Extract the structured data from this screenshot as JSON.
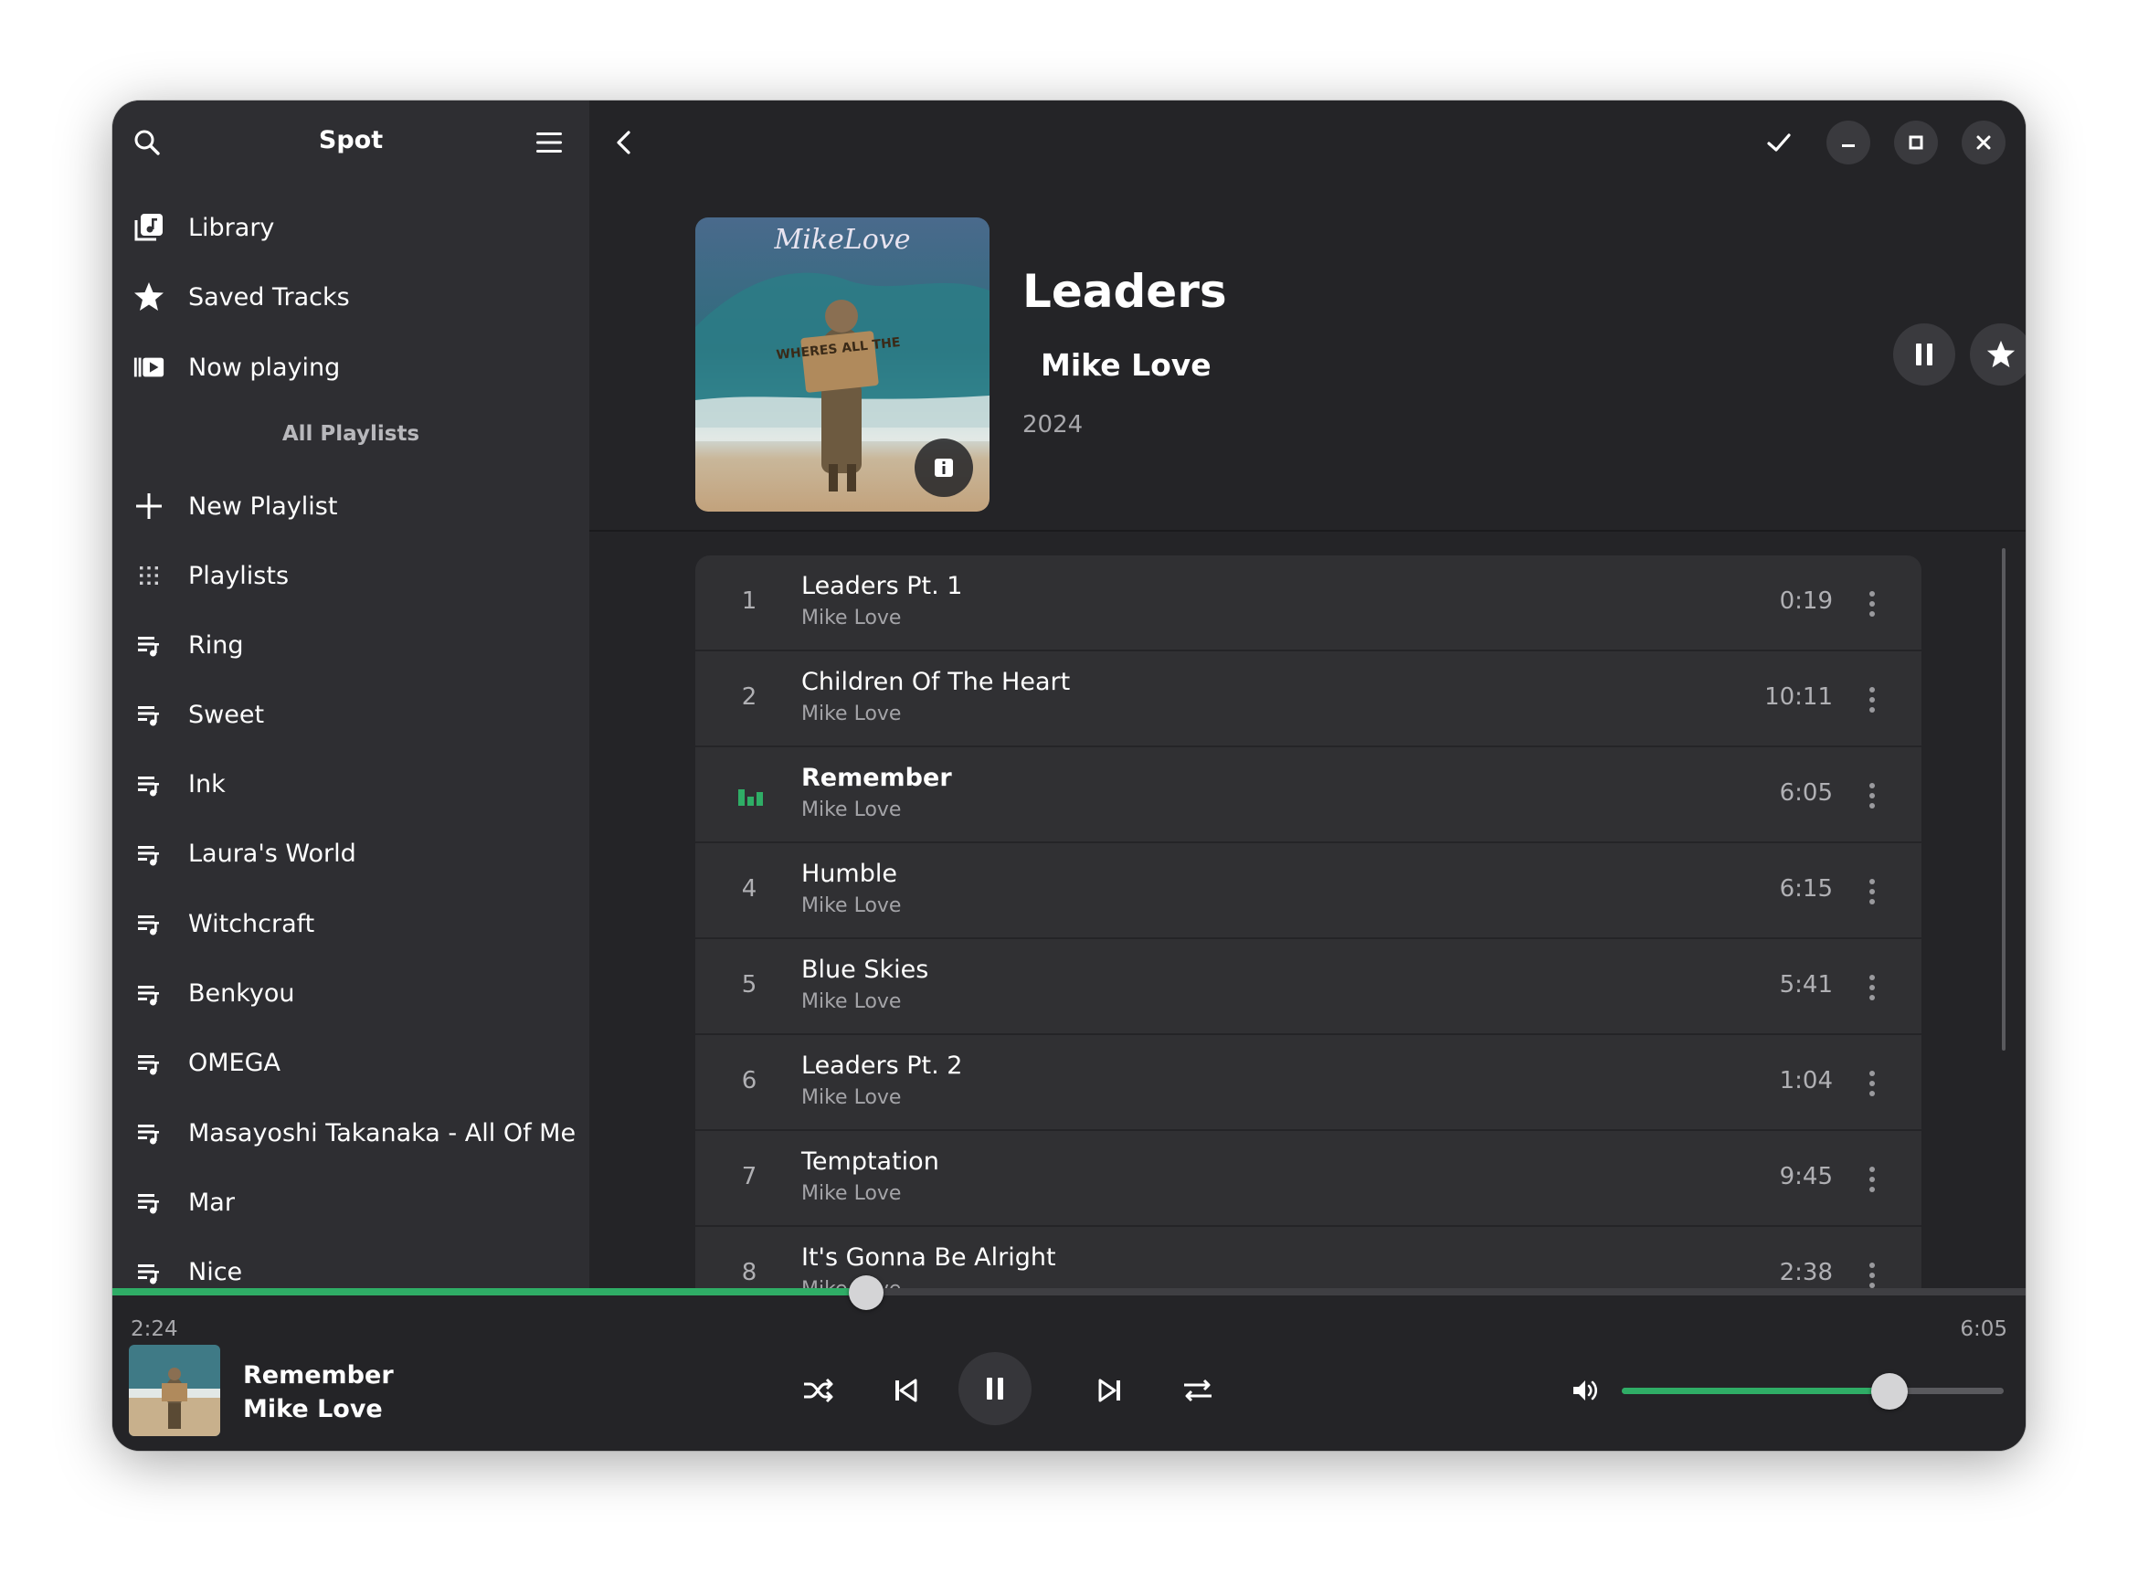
{
  "app": {
    "title": "Spot"
  },
  "sidebar": {
    "nav": [
      {
        "label": "Library",
        "icon": "library-icon"
      },
      {
        "label": "Saved Tracks",
        "icon": "star-icon"
      },
      {
        "label": "Now playing",
        "icon": "now-playing-icon"
      }
    ],
    "section_title": "All Playlists",
    "new_playlist": {
      "label": "New Playlist",
      "icon": "plus-icon"
    },
    "playlists_item": {
      "label": "Playlists",
      "icon": "grid-icon"
    },
    "playlists": [
      "Ring",
      "Sweet",
      "Ink",
      "Laura's World",
      "Witchcraft",
      "Benkyou",
      "OMEGA",
      "Masayoshi Takanaka - All Of Me",
      "Mar",
      "Nice"
    ]
  },
  "album": {
    "title": "Leaders",
    "artist": "Mike Love",
    "year": "2024",
    "cover_text": {
      "top": "MikeLove",
      "sign": "WHERES ALL THE"
    },
    "is_playing": true,
    "is_saved": false
  },
  "tracks": [
    {
      "number": "1",
      "title": "Leaders Pt. 1",
      "artist": "Mike Love",
      "duration": "0:19",
      "playing": false
    },
    {
      "number": "2",
      "title": "Children Of The Heart",
      "artist": "Mike Love",
      "duration": "10:11",
      "playing": false
    },
    {
      "number": "3",
      "title": "Remember",
      "artist": "Mike Love",
      "duration": "6:05",
      "playing": true
    },
    {
      "number": "4",
      "title": "Humble",
      "artist": "Mike Love",
      "duration": "6:15",
      "playing": false
    },
    {
      "number": "5",
      "title": "Blue Skies",
      "artist": "Mike Love",
      "duration": "5:41",
      "playing": false
    },
    {
      "number": "6",
      "title": "Leaders Pt. 2",
      "artist": "Mike Love",
      "duration": "1:04",
      "playing": false
    },
    {
      "number": "7",
      "title": "Temptation",
      "artist": "Mike Love",
      "duration": "9:45",
      "playing": false
    },
    {
      "number": "8",
      "title": "It's Gonna Be Alright",
      "artist": "Mike Love",
      "duration": "2:38",
      "playing": false
    }
  ],
  "player": {
    "now_playing": {
      "title": "Remember",
      "artist": "Mike Love"
    },
    "elapsed": "2:24",
    "total": "6:05",
    "progress_fraction": 0.394,
    "volume_fraction": 0.7
  },
  "colors": {
    "accent": "#2fad66",
    "background": "#242427",
    "sidebar": "#2e2e32",
    "track_row": "#303033"
  }
}
